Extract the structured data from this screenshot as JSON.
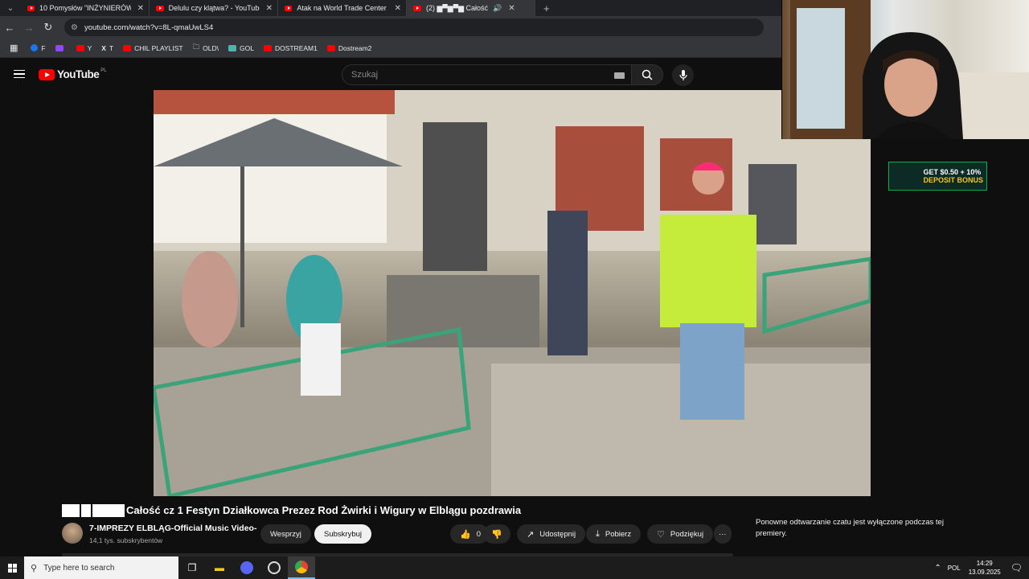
{
  "browser": {
    "tabs": [
      {
        "title": "10 Pomysłów \"INŻYNIERÓW\" z",
        "active": false
      },
      {
        "title": "Delulu czy klątwa? - YouTube",
        "active": false
      },
      {
        "title": "Atak na World Trade Center (c",
        "active": false
      },
      {
        "title": "(2) ▆▀▆▀▆ Całość",
        "active": true
      }
    ],
    "url": "youtube.com/watch?v=8L-qmaUwLS4",
    "bookmarks": [
      "F",
      "Y",
      "T",
      "CHIL PLAYLIST",
      "OLD\\",
      "GOL",
      "DOSTREAM1",
      "Dostream2"
    ]
  },
  "youtube": {
    "logo": "YouTube",
    "region": "PL",
    "search_placeholder": "Szukaj",
    "video_title": "Całość cz 1 Festyn Działkowca Prezez Rod Żwirki i Wigury w Elblągu pozdrawia",
    "channel_name": "7-IMPREZY ELBLĄG-Official Music Video-",
    "subscribers": "14,1 tys. subskrybentów",
    "buttons": {
      "support": "Wesprzyj",
      "subscribe": "Subskrybuj",
      "likes": "0",
      "share": "Udostępnij",
      "download": "Pobierz",
      "thanks": "Podziękuj",
      "more": "···"
    },
    "chat_notice": "Ponowne odtwarzanie czatu jest wyłączone podczas tej premiery."
  },
  "ad": {
    "line1": "GET $0.50 + 10%",
    "line2": "DEPOSIT BONUS"
  },
  "taskbar": {
    "search_placeholder": "Type here to search",
    "language": "POL",
    "time": "14:29",
    "date": "13.09.2025"
  }
}
